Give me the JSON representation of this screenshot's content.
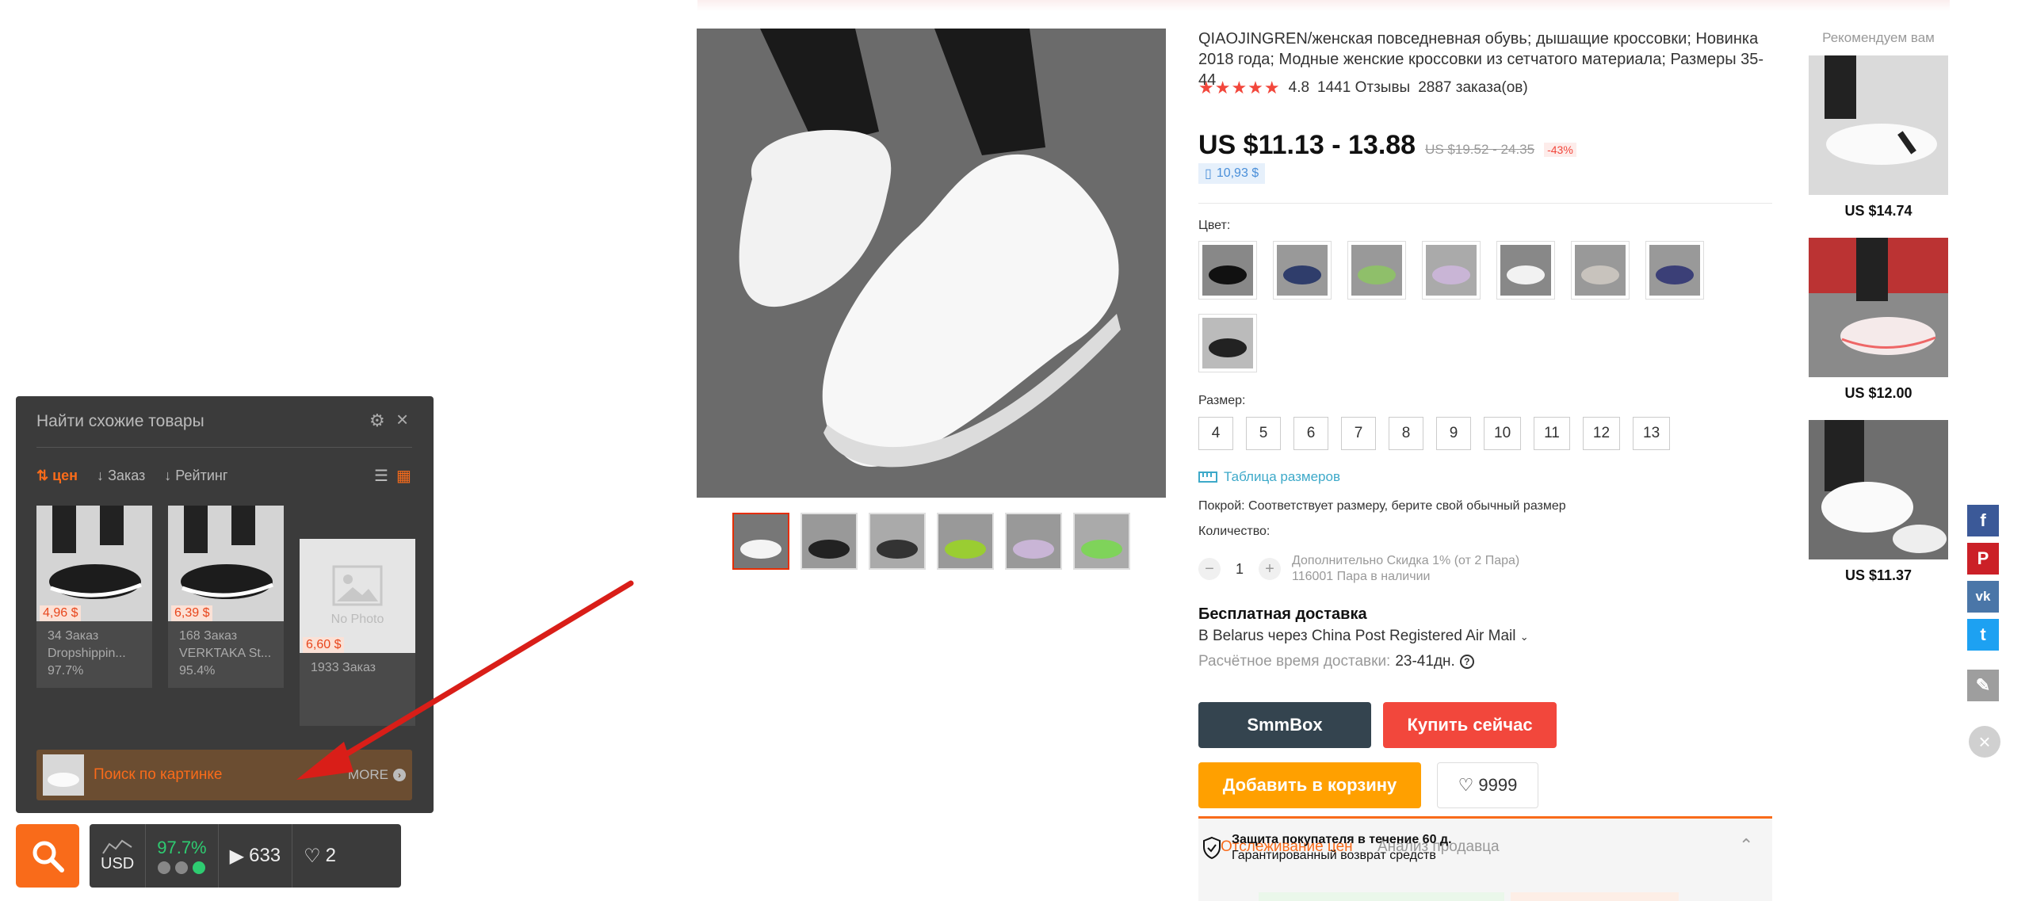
{
  "product": {
    "title": "QIAOJINGREN/женская повседневная обувь; дышащие кроссовки; Новинка 2018 года; Модные женские кроссовки из сетчатого материала; Размеры 35-44",
    "rating": "4.8",
    "reviews": "1441 Отзывы",
    "orders": "2887 заказа(ов)",
    "price": "US $11.13 - 13.88",
    "old_price": "US $19.52 - 24.35",
    "discount": "-43%",
    "app_price": "10,93 $",
    "color_label": "Цвет:",
    "size_label": "Размер:",
    "sizes": [
      "4",
      "5",
      "6",
      "7",
      "8",
      "9",
      "10",
      "11",
      "12",
      "13"
    ],
    "size_table_link": "Таблица размеров",
    "fit_note": "Покрой: Соответствует размеру, берите свой обычный размер",
    "quantity_label": "Количество:",
    "quantity_value": "1",
    "quantity_discount": "Дополнительно Скидка 1% (от 2 Пара)",
    "quantity_stock": "116001 Пара в наличии",
    "shipping_title": "Бесплатная доставка",
    "shipping_method": "В Belarus через China Post Registered Air Mail",
    "delivery_label": "Расчётное время доставки:",
    "delivery_value": "23-41дн.",
    "btn_smmbox": "SmmBox",
    "btn_buy": "Купить сейчас",
    "btn_cart": "Добавить в корзину",
    "wishlist_count": "9999",
    "tab_price_tracking": "Отслеживание цен",
    "tab_seller_analysis": "Анализ продавца",
    "guarantee_title": "Защита покупателя в течение 60 д.",
    "guarantee_sub": "Гарантированный возврат средств"
  },
  "recommended": {
    "title": "Рекомендуем вам",
    "items": [
      {
        "price": "US $14.74"
      },
      {
        "price": "US $12.00"
      },
      {
        "price": "US $11.37"
      }
    ]
  },
  "social": [
    {
      "name": "facebook",
      "glyph": "f",
      "color": "#3b5998"
    },
    {
      "name": "pinterest",
      "glyph": "P",
      "color": "#cb2027"
    },
    {
      "name": "vk",
      "glyph": "vk",
      "color": "#4a76a8"
    },
    {
      "name": "twitter",
      "glyph": "t",
      "color": "#1da1f2"
    },
    {
      "name": "edit",
      "glyph": "✎",
      "color": "#9e9e9e"
    }
  ],
  "panel": {
    "title": "Найти схожие товары",
    "sort_price": "цен",
    "sort_orders": "Заказ",
    "sort_rating": "Рейтинг",
    "cards": [
      {
        "price": "4,96 $",
        "orders": "34 Заказ",
        "seller": "Dropshippin...",
        "rating": "97.7%"
      },
      {
        "price": "6,39 $",
        "orders": "168 Заказ",
        "seller": "VERKTAKA St...",
        "rating": "95.4%"
      },
      {
        "price": "6,60 $",
        "orders": "1933 Заказ",
        "no_photo": "No Photo"
      }
    ],
    "search_by_image": "Поиск по картинке",
    "more": "MORE"
  },
  "widget": {
    "currency": "USD",
    "rating": "97.7%",
    "views": "633",
    "likes": "2"
  },
  "colors": {
    "accent": "#f96b1a",
    "buy": "#f2473c",
    "cart": "#ffa000",
    "dark": "#34444f"
  }
}
